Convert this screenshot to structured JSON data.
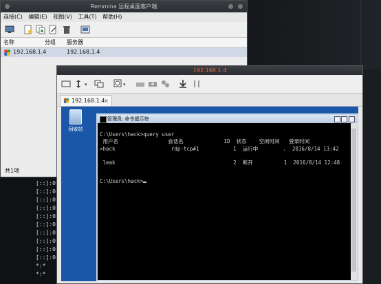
{
  "remmina": {
    "title": "Remmina 远程桌面客户端",
    "menu": [
      "连接(C)",
      "编辑(E)",
      "视图(V)",
      "工具(T)",
      "帮助(H)"
    ],
    "toolbar_icons": [
      "connect-icon",
      "new-icon",
      "copy-icon",
      "edit-icon",
      "delete-icon",
      "preferences-icon"
    ],
    "columns": {
      "name": "名称",
      "group": "分组",
      "server": "服务器"
    },
    "rows": [
      {
        "name": "192.168.1.4",
        "group": "",
        "server": "192.168.1.4"
      }
    ],
    "status": "共1项"
  },
  "connection": {
    "title": "192.168.1.4",
    "tab_label": "192.168.1.4",
    "tab_close": "×",
    "toolbar_icons": [
      "fullscreen-icon",
      "scale-icon",
      "view-only-icon",
      "zoom-icon",
      "grab-keyboard-icon",
      "screenshot-icon",
      "preferences-icon",
      "minimize-icon",
      "disconnect-icon"
    ]
  },
  "desktop": {
    "recycle_bin": "回收站"
  },
  "cmd": {
    "title": "管理员: 命令提示符",
    "lines": {
      "cmd1": "C:\\Users\\hack>query user",
      "header": " 用户名                会话名             ID  状态    空闲时间   登录时间",
      "row1": ">hack                  rdp-tcp#1           1  运行中        .  2016/8/14 13:42",
      "row2": " leak                                      2  断开          1  2016/8/14 12:48",
      "prompt": "C:\\Users\\hack>"
    }
  },
  "background_terminal": {
    "lines": [
      "[::]:0",
      "[::]:0",
      "[::]:0",
      "[::]:0",
      "[::]:0",
      "[::]:0",
      "[::]:0",
      "[::]:0",
      "[::]:0",
      "[::]:0",
      "*:*",
      "*:*"
    ]
  }
}
